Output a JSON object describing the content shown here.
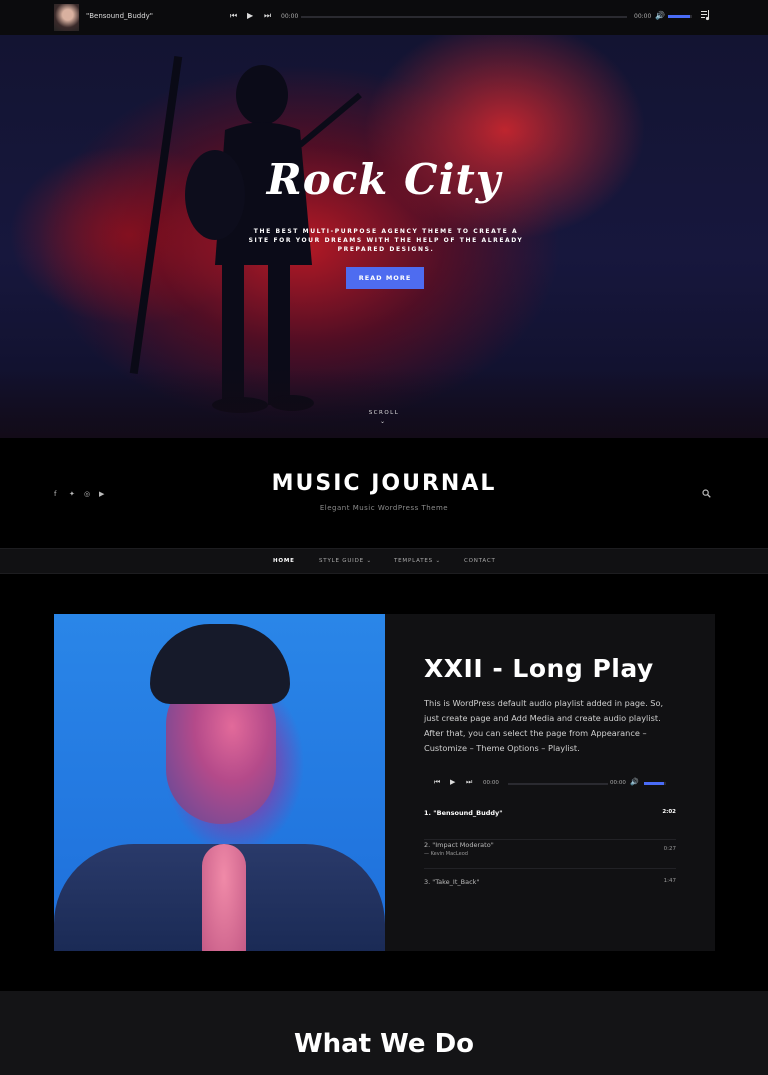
{
  "player": {
    "track": "\"Bensound_Buddy\"",
    "time_current": "00:00",
    "time_total": "00:00",
    "volume_fraction": 0.9
  },
  "hero": {
    "title": "Rock City",
    "subtitle": "THE BEST MULTI-PURPOSE AGENCY THEME TO CREATE A SITE FOR YOUR DREAMS WITH THE HELP OF THE ALREADY PREPARED DESIGNS.",
    "button": "READ MORE",
    "scroll": "SCROLL",
    "colors": {
      "button": "#4e6cf0",
      "accent_red": "#c8192a",
      "navy": "#17173d"
    }
  },
  "header": {
    "site_title": "MUSIC JOURNAL",
    "tagline": "Elegant Music WordPress Theme",
    "social": [
      "f",
      "t",
      "ig",
      "yt"
    ]
  },
  "nav": {
    "items": [
      {
        "label": "HOME"
      },
      {
        "label": "STYLE GUIDE ⌄"
      },
      {
        "label": "TEMPLATES ⌄"
      },
      {
        "label": "CONTACT"
      }
    ]
  },
  "playlist": {
    "title": "XXII - Long Play",
    "description": "This is WordPress default audio playlist added in page. So, just create page and Add Media and create audio playlist. After that, you can select the page from Appearance – Customize – Theme Options – Playlist.",
    "time_current": "00:00",
    "time_total": "00:00",
    "volume_fraction": 0.9,
    "tracks": [
      {
        "name": "1. \"Bensound_Buddy\"",
        "artist": "",
        "duration": "2:02"
      },
      {
        "name": "2. \"Impact Moderato\"",
        "artist": "— Kevin MacLeod",
        "duration": "0:27"
      },
      {
        "name": "3. \"Take_It_Back\"",
        "artist": "",
        "duration": "1:47"
      }
    ]
  },
  "section": {
    "title": "What We Do"
  }
}
